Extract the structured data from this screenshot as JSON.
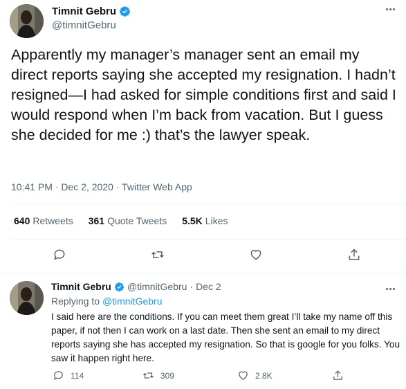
{
  "main_tweet": {
    "author_name": "Timnit Gebru",
    "handle": "@timnitGebru",
    "text": "Apparently my manager’s manager sent an email my direct reports saying she accepted my resignation. I hadn’t resigned—I had asked for simple conditions first and said I would respond when I’m back from vacation. But I guess she decided for me :) that’s the lawyer speak.",
    "time": "10:41 PM",
    "separator": "·",
    "date": "Dec 2, 2020",
    "source": "Twitter Web App",
    "stats": {
      "retweets_count": "640",
      "retweets_label": "Retweets",
      "quotes_count": "361",
      "quotes_label": "Quote Tweets",
      "likes_count": "5.5K",
      "likes_label": "Likes"
    }
  },
  "reply_tweet": {
    "author_name": "Timnit Gebru",
    "handle": "@timnitGebru",
    "separator": "·",
    "date": "Dec 2",
    "replying_label": "Replying to",
    "replying_handle": "@timnitGebru",
    "text": "I said here are the conditions. If you can meet them great I’ll take my name off this paper, if not then I can work on a last date. Then she sent an email to my direct reports saying she has accepted my resignation. So that is google for you folks. You saw it happen right here.",
    "reply_count": "114",
    "retweet_count": "309",
    "like_count": "2.8K"
  },
  "icons": {
    "verified": "verified-badge-icon",
    "more": "more-icon",
    "reply": "reply-icon",
    "retweet": "retweet-icon",
    "like": "heart-icon",
    "share": "share-icon"
  },
  "colors": {
    "text": "#0f1419",
    "secondary": "#536471",
    "link": "#1d9bf0",
    "verified": "#1d9bf0",
    "divider": "#eff3f4"
  }
}
